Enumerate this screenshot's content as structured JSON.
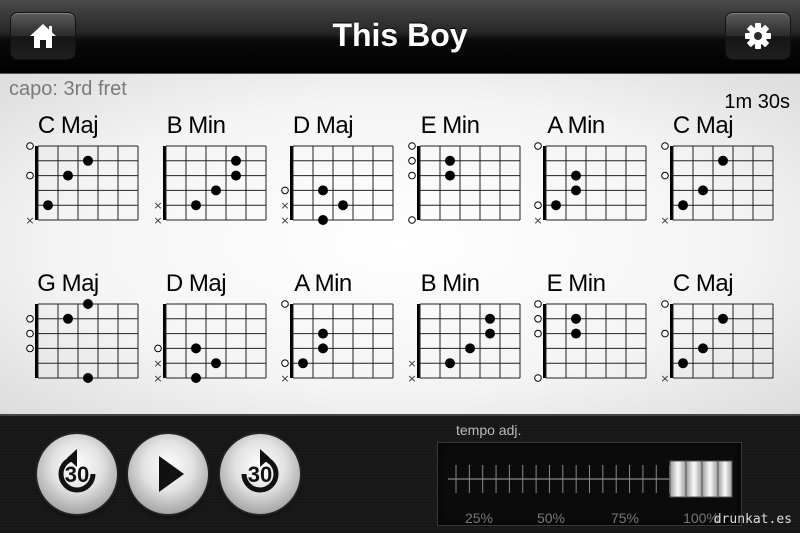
{
  "header": {
    "title": "This Boy",
    "home_icon": "home-icon",
    "settings_icon": "gear-icon"
  },
  "song_info": {
    "capo": "capo: 3rd fret",
    "duration": "1m 30s"
  },
  "chords": [
    {
      "name": "C Maj",
      "strings": [
        "x",
        "3",
        "2",
        "o",
        "1",
        "o"
      ],
      "dots": [
        [
          2,
          3
        ],
        [
          3,
          2
        ],
        [
          5,
          1
        ]
      ]
    },
    {
      "name": "B Min",
      "strings": [
        "x",
        "x",
        "4",
        "4",
        "3",
        "2"
      ],
      "dots": [
        [
          5,
          2
        ],
        [
          4,
          3
        ],
        [
          2,
          4
        ],
        [
          3,
          4
        ]
      ]
    },
    {
      "name": "D Maj",
      "strings": [
        "x",
        "x",
        "o",
        "2",
        "3",
        "2"
      ],
      "dots": [
        [
          4,
          2
        ],
        [
          6,
          2
        ],
        [
          5,
          3
        ]
      ]
    },
    {
      "name": "E Min",
      "strings": [
        "o",
        "2",
        "2",
        "o",
        "o",
        "o"
      ],
      "dots": [
        [
          2,
          2
        ],
        [
          3,
          2
        ]
      ]
    },
    {
      "name": "A Min",
      "strings": [
        "x",
        "o",
        "2",
        "2",
        "1",
        "o"
      ],
      "dots": [
        [
          5,
          1
        ],
        [
          3,
          2
        ],
        [
          4,
          2
        ]
      ]
    },
    {
      "name": "C Maj",
      "strings": [
        "x",
        "3",
        "2",
        "o",
        "1",
        "o"
      ],
      "dots": [
        [
          5,
          1
        ],
        [
          4,
          2
        ],
        [
          2,
          3
        ]
      ]
    },
    {
      "name": "G Maj",
      "strings": [
        "3",
        "2",
        "o",
        "o",
        "o",
        "3"
      ],
      "dots": [
        [
          6,
          3
        ],
        [
          2,
          2
        ],
        [
          1,
          3
        ]
      ]
    },
    {
      "name": "D Maj",
      "strings": [
        "x",
        "x",
        "o",
        "2",
        "3",
        "2"
      ],
      "dots": [
        [
          4,
          2
        ],
        [
          6,
          2
        ],
        [
          5,
          3
        ]
      ]
    },
    {
      "name": "A Min",
      "strings": [
        "x",
        "o",
        "2",
        "2",
        "1",
        "o"
      ],
      "dots": [
        [
          5,
          1
        ],
        [
          3,
          2
        ],
        [
          4,
          2
        ]
      ]
    },
    {
      "name": "B Min",
      "strings": [
        "x",
        "x",
        "4",
        "4",
        "3",
        "2"
      ],
      "dots": [
        [
          5,
          2
        ],
        [
          4,
          3
        ],
        [
          2,
          4
        ],
        [
          3,
          4
        ]
      ]
    },
    {
      "name": "E Min",
      "strings": [
        "o",
        "2",
        "2",
        "o",
        "o",
        "o"
      ],
      "dots": [
        [
          2,
          2
        ],
        [
          3,
          2
        ]
      ]
    },
    {
      "name": "C Maj",
      "strings": [
        "x",
        "3",
        "2",
        "o",
        "1",
        "o"
      ],
      "dots": [
        [
          5,
          1
        ],
        [
          4,
          2
        ],
        [
          2,
          3
        ]
      ]
    }
  ],
  "controls": {
    "rewind_label": "30",
    "forward_label": "30",
    "rewind_icon": "rewind-30-icon",
    "play_icon": "play-icon",
    "forward_icon": "forward-30-icon"
  },
  "tempo": {
    "label": "tempo adj.",
    "ticks": [
      "25%",
      "50%",
      "75%",
      "100%"
    ],
    "value_percent": 100
  },
  "watermark": "drunkat.es"
}
